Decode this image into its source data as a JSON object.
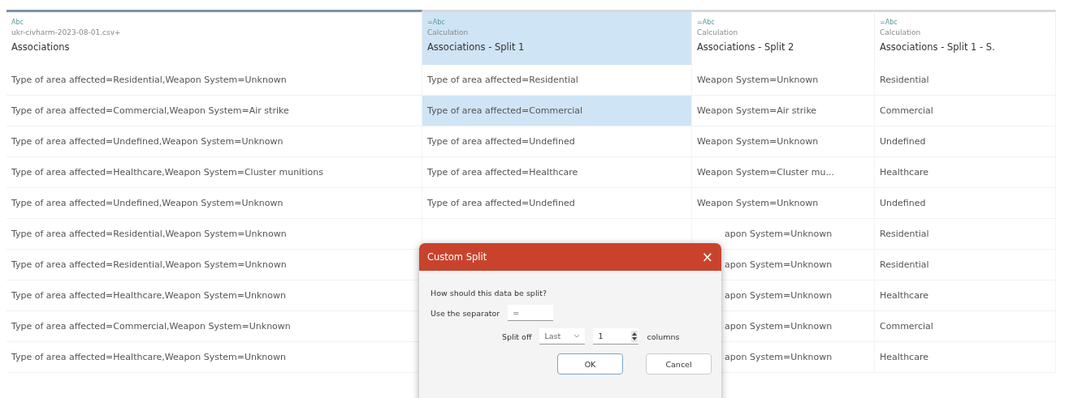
{
  "columns": [
    {
      "type_label": "Abc",
      "source": "ukr-civharm-2023-08-01.csv+",
      "name": "Associations",
      "selected": false,
      "active_top": true
    },
    {
      "type_label": "=Abc",
      "source": "Calculation",
      "name": "Associations - Split 1",
      "selected": true,
      "active_top": false
    },
    {
      "type_label": "=Abc",
      "source": "Calculation",
      "name": "Associations - Split 2",
      "selected": false,
      "active_top": false
    },
    {
      "type_label": "=Abc",
      "source": "Calculation",
      "name": "Associations - Split 1 - S.",
      "selected": false,
      "active_top": false
    }
  ],
  "rows": [
    {
      "under_dialog": false,
      "cells": [
        {
          "text": "Type of area affected=Residential,Weapon System=Unknown",
          "selected": false
        },
        {
          "text": "Type of area affected=Residential",
          "selected": false
        },
        {
          "text": "Weapon System=Unknown",
          "selected": false
        },
        {
          "text": "Residential",
          "selected": false
        }
      ]
    },
    {
      "under_dialog": false,
      "cells": [
        {
          "text": "Type of area affected=Commercial,Weapon System=Air strike",
          "selected": false
        },
        {
          "text": "Type of area affected=Commercial",
          "selected": true
        },
        {
          "text": "Weapon System=Air strike",
          "selected": false
        },
        {
          "text": "Commercial",
          "selected": false
        }
      ]
    },
    {
      "under_dialog": false,
      "cells": [
        {
          "text": "Type of area affected=Undefined,Weapon System=Unknown",
          "selected": false
        },
        {
          "text": "Type of area affected=Undefined",
          "selected": false
        },
        {
          "text": "Weapon System=Unknown",
          "selected": false
        },
        {
          "text": "Undefined",
          "selected": false
        }
      ]
    },
    {
      "under_dialog": false,
      "cells": [
        {
          "text": "Type of area affected=Healthcare,Weapon System=Cluster munitions",
          "selected": false
        },
        {
          "text": "Type of area affected=Healthcare",
          "selected": false
        },
        {
          "text": "Weapon System=Cluster mu...",
          "selected": false
        },
        {
          "text": "Healthcare",
          "selected": false
        }
      ]
    },
    {
      "under_dialog": false,
      "cells": [
        {
          "text": "Type of area affected=Undefined,Weapon System=Unknown",
          "selected": false
        },
        {
          "text": "Type of area affected=Undefined",
          "selected": false
        },
        {
          "text": "Weapon System=Unknown",
          "selected": false
        },
        {
          "text": "Undefined",
          "selected": false
        }
      ]
    },
    {
      "under_dialog": true,
      "cells": [
        {
          "text": "Type of area affected=Residential,Weapon System=Unknown",
          "selected": false
        },
        null,
        {
          "text": "apon System=Unknown",
          "selected": false
        },
        {
          "text": "Residential",
          "selected": false
        }
      ]
    },
    {
      "under_dialog": true,
      "cells": [
        {
          "text": "Type of area affected=Residential,Weapon System=Unknown",
          "selected": false
        },
        null,
        {
          "text": "apon System=Unknown",
          "selected": false
        },
        {
          "text": "Residential",
          "selected": false
        }
      ]
    },
    {
      "under_dialog": true,
      "cells": [
        {
          "text": "Type of area affected=Healthcare,Weapon System=Unknown",
          "selected": false
        },
        null,
        {
          "text": "apon System=Unknown",
          "selected": false
        },
        {
          "text": "Healthcare",
          "selected": false
        }
      ]
    },
    {
      "under_dialog": true,
      "cells": [
        {
          "text": "Type of area affected=Commercial,Weapon System=Unknown",
          "selected": false
        },
        null,
        {
          "text": "apon System=Unknown",
          "selected": false
        },
        {
          "text": "Commercial",
          "selected": false
        }
      ]
    },
    {
      "under_dialog": true,
      "cells": [
        {
          "text": "Type of area affected=Healthcare,Weapon System=Unknown",
          "selected": false
        },
        null,
        {
          "text": "apon System=Unknown",
          "selected": false
        },
        {
          "text": "Healthcare",
          "selected": false
        }
      ]
    }
  ],
  "dialog": {
    "title": "Custom Split",
    "close": "×",
    "question": "How should this data be split?",
    "separator_label": "Use the separator",
    "separator_value": "=",
    "split_label": "Split off",
    "split_mode": "Last",
    "count": "1",
    "columns_label": "columns",
    "buttons": [
      {
        "label": "OK",
        "focused": true
      },
      {
        "label": "Cancel",
        "focused": false
      }
    ]
  }
}
